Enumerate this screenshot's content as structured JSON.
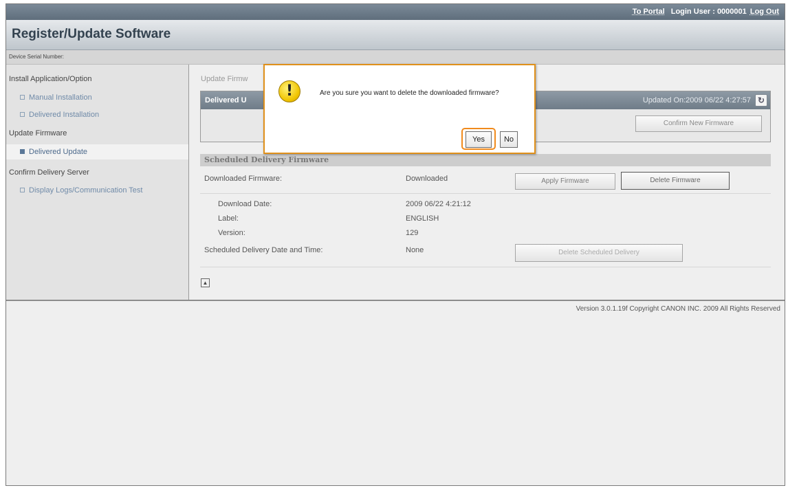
{
  "header": {
    "portal_link": "To Portal",
    "login_user": "Login User : 0000001",
    "logout_link": "Log Out"
  },
  "page_title": "Register/Update Software",
  "device_serial_label": "Device Serial Number:",
  "sidebar": {
    "sections": [
      {
        "label": "Install Application/Option",
        "items": [
          {
            "label": "Manual Installation"
          },
          {
            "label": "Delivered Installation"
          }
        ]
      },
      {
        "label": "Update Firmware",
        "items": [
          {
            "label": "Delivered Update",
            "active": true
          }
        ]
      },
      {
        "label": "Confirm Delivery Server",
        "items": [
          {
            "label": "Display Logs/Communication Test"
          }
        ]
      }
    ]
  },
  "main": {
    "breadcrumb": "Update Firmw",
    "delivered_update": {
      "title": "Delivered U",
      "updated_on": "Updated On:2009 06/22 4:27:57",
      "confirm_button": "Confirm New Firmware"
    },
    "scheduled": {
      "title": "Scheduled Delivery Firmware",
      "downloaded_firmware_label": "Downloaded Firmware:",
      "downloaded_firmware_value": "Downloaded",
      "apply_button": "Apply Firmware",
      "delete_button": "Delete Firmware",
      "download_date_label": "Download Date:",
      "download_date_value": "2009 06/22 4:21:12",
      "label_label": "Label:",
      "label_value": "ENGLISH",
      "version_label": "Version:",
      "version_value": "129",
      "scheduled_date_label": "Scheduled Delivery Date and Time:",
      "scheduled_date_value": "None",
      "delete_scheduled_button": "Delete Scheduled Delivery"
    }
  },
  "footer": "Version 3.0.1.19f Copyright CANON INC. 2009 All Rights Reserved",
  "dialog": {
    "message": "Are you sure you want to delete the downloaded firmware?",
    "yes_label": "Yes",
    "no_label": "No"
  },
  "icons": {
    "warning": "warning-icon",
    "refresh": "refresh-icon",
    "back_to_top": "back-to-top-icon"
  },
  "colors": {
    "dialog_border": "#e0901a",
    "highlight": "#f08a1c",
    "panel_header": "#7d8a96",
    "link_blue": "#6f8aa8"
  }
}
